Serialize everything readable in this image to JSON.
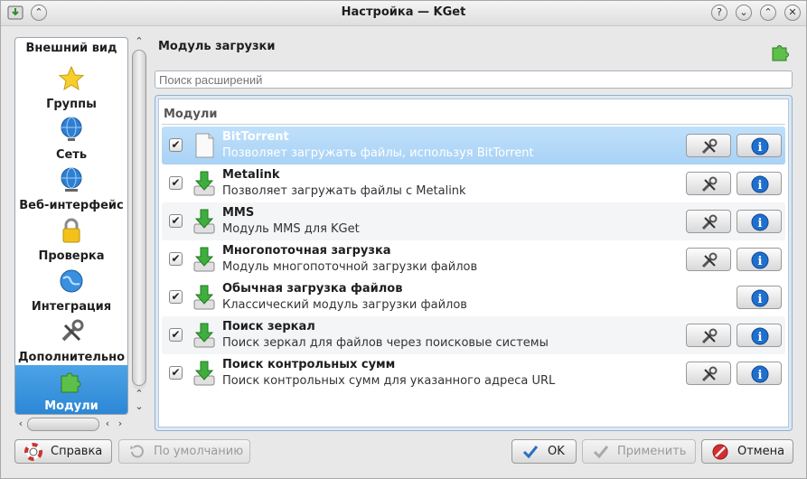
{
  "window": {
    "title": "Настройка — KGet"
  },
  "sidebar": {
    "items": [
      {
        "label": "Внешний вид",
        "icon": "appearance-icon"
      },
      {
        "label": "Группы",
        "icon": "star-icon"
      },
      {
        "label": "Сеть",
        "icon": "globe-icon"
      },
      {
        "label": "Веб-интерфейс",
        "icon": "globe-network-icon"
      },
      {
        "label": "Проверка",
        "icon": "lock-icon"
      },
      {
        "label": "Интеграция",
        "icon": "globe-integration-icon"
      },
      {
        "label": "Дополнительно",
        "icon": "tools-icon"
      },
      {
        "label": "Модули",
        "icon": "puzzle-icon"
      }
    ],
    "active_index": 7
  },
  "main": {
    "title": "Модуль загрузки",
    "search": {
      "placeholder": "Поиск расширений",
      "value": ""
    },
    "list_header": "Модули",
    "rows": [
      {
        "name": "BitTorrent",
        "description": "Позволяет загружать файлы, используя BitTorrent",
        "checked": true,
        "configurable": true,
        "selected": true
      },
      {
        "name": "Metalink",
        "description": "Позволяет загружать файлы с Metalink",
        "checked": true,
        "configurable": true,
        "selected": false
      },
      {
        "name": "MMS",
        "description": "Модуль MMS для KGet",
        "checked": true,
        "configurable": true,
        "selected": false
      },
      {
        "name": "Многопоточная загрузка",
        "description": "Модуль многопоточной загрузки файлов",
        "checked": true,
        "configurable": true,
        "selected": false
      },
      {
        "name": "Обычная загрузка файлов",
        "description": "Классический модуль загрузки файлов",
        "checked": true,
        "configurable": false,
        "selected": false
      },
      {
        "name": "Поиск зеркал",
        "description": "Поиск зеркал для файлов через поисковые системы",
        "checked": true,
        "configurable": true,
        "selected": false
      },
      {
        "name": "Поиск контрольных сумм",
        "description": "Поиск контрольных сумм для указанного адреса URL",
        "checked": true,
        "configurable": true,
        "selected": false
      }
    ]
  },
  "buttons": {
    "help": "Справка",
    "defaults": "По умолчанию",
    "ok": "OK",
    "apply": "Применить",
    "cancel": "Отмена"
  },
  "colors": {
    "accent": "#3a96dd",
    "selection": "#b4d8f7",
    "plugin_green": "#3fa34d"
  }
}
